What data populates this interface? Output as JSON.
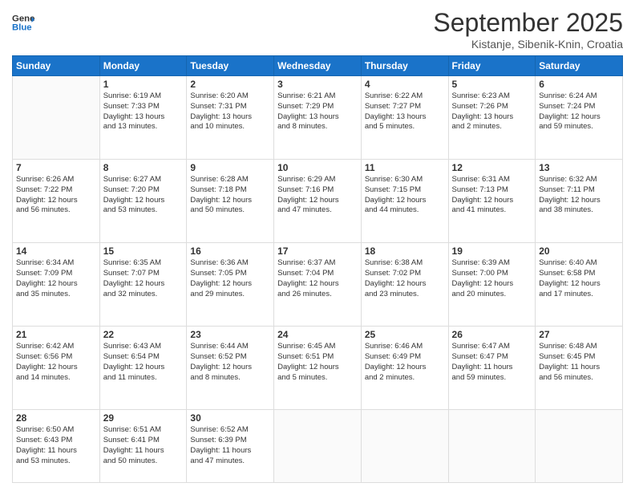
{
  "header": {
    "logo_line1": "General",
    "logo_line2": "Blue",
    "month": "September 2025",
    "location": "Kistanje, Sibenik-Knin, Croatia"
  },
  "days_of_week": [
    "Sunday",
    "Monday",
    "Tuesday",
    "Wednesday",
    "Thursday",
    "Friday",
    "Saturday"
  ],
  "weeks": [
    [
      {
        "day": "",
        "info": ""
      },
      {
        "day": "1",
        "info": "Sunrise: 6:19 AM\nSunset: 7:33 PM\nDaylight: 13 hours\nand 13 minutes."
      },
      {
        "day": "2",
        "info": "Sunrise: 6:20 AM\nSunset: 7:31 PM\nDaylight: 13 hours\nand 10 minutes."
      },
      {
        "day": "3",
        "info": "Sunrise: 6:21 AM\nSunset: 7:29 PM\nDaylight: 13 hours\nand 8 minutes."
      },
      {
        "day": "4",
        "info": "Sunrise: 6:22 AM\nSunset: 7:27 PM\nDaylight: 13 hours\nand 5 minutes."
      },
      {
        "day": "5",
        "info": "Sunrise: 6:23 AM\nSunset: 7:26 PM\nDaylight: 13 hours\nand 2 minutes."
      },
      {
        "day": "6",
        "info": "Sunrise: 6:24 AM\nSunset: 7:24 PM\nDaylight: 12 hours\nand 59 minutes."
      }
    ],
    [
      {
        "day": "7",
        "info": "Sunrise: 6:26 AM\nSunset: 7:22 PM\nDaylight: 12 hours\nand 56 minutes."
      },
      {
        "day": "8",
        "info": "Sunrise: 6:27 AM\nSunset: 7:20 PM\nDaylight: 12 hours\nand 53 minutes."
      },
      {
        "day": "9",
        "info": "Sunrise: 6:28 AM\nSunset: 7:18 PM\nDaylight: 12 hours\nand 50 minutes."
      },
      {
        "day": "10",
        "info": "Sunrise: 6:29 AM\nSunset: 7:16 PM\nDaylight: 12 hours\nand 47 minutes."
      },
      {
        "day": "11",
        "info": "Sunrise: 6:30 AM\nSunset: 7:15 PM\nDaylight: 12 hours\nand 44 minutes."
      },
      {
        "day": "12",
        "info": "Sunrise: 6:31 AM\nSunset: 7:13 PM\nDaylight: 12 hours\nand 41 minutes."
      },
      {
        "day": "13",
        "info": "Sunrise: 6:32 AM\nSunset: 7:11 PM\nDaylight: 12 hours\nand 38 minutes."
      }
    ],
    [
      {
        "day": "14",
        "info": "Sunrise: 6:34 AM\nSunset: 7:09 PM\nDaylight: 12 hours\nand 35 minutes."
      },
      {
        "day": "15",
        "info": "Sunrise: 6:35 AM\nSunset: 7:07 PM\nDaylight: 12 hours\nand 32 minutes."
      },
      {
        "day": "16",
        "info": "Sunrise: 6:36 AM\nSunset: 7:05 PM\nDaylight: 12 hours\nand 29 minutes."
      },
      {
        "day": "17",
        "info": "Sunrise: 6:37 AM\nSunset: 7:04 PM\nDaylight: 12 hours\nand 26 minutes."
      },
      {
        "day": "18",
        "info": "Sunrise: 6:38 AM\nSunset: 7:02 PM\nDaylight: 12 hours\nand 23 minutes."
      },
      {
        "day": "19",
        "info": "Sunrise: 6:39 AM\nSunset: 7:00 PM\nDaylight: 12 hours\nand 20 minutes."
      },
      {
        "day": "20",
        "info": "Sunrise: 6:40 AM\nSunset: 6:58 PM\nDaylight: 12 hours\nand 17 minutes."
      }
    ],
    [
      {
        "day": "21",
        "info": "Sunrise: 6:42 AM\nSunset: 6:56 PM\nDaylight: 12 hours\nand 14 minutes."
      },
      {
        "day": "22",
        "info": "Sunrise: 6:43 AM\nSunset: 6:54 PM\nDaylight: 12 hours\nand 11 minutes."
      },
      {
        "day": "23",
        "info": "Sunrise: 6:44 AM\nSunset: 6:52 PM\nDaylight: 12 hours\nand 8 minutes."
      },
      {
        "day": "24",
        "info": "Sunrise: 6:45 AM\nSunset: 6:51 PM\nDaylight: 12 hours\nand 5 minutes."
      },
      {
        "day": "25",
        "info": "Sunrise: 6:46 AM\nSunset: 6:49 PM\nDaylight: 12 hours\nand 2 minutes."
      },
      {
        "day": "26",
        "info": "Sunrise: 6:47 AM\nSunset: 6:47 PM\nDaylight: 11 hours\nand 59 minutes."
      },
      {
        "day": "27",
        "info": "Sunrise: 6:48 AM\nSunset: 6:45 PM\nDaylight: 11 hours\nand 56 minutes."
      }
    ],
    [
      {
        "day": "28",
        "info": "Sunrise: 6:50 AM\nSunset: 6:43 PM\nDaylight: 11 hours\nand 53 minutes."
      },
      {
        "day": "29",
        "info": "Sunrise: 6:51 AM\nSunset: 6:41 PM\nDaylight: 11 hours\nand 50 minutes."
      },
      {
        "day": "30",
        "info": "Sunrise: 6:52 AM\nSunset: 6:39 PM\nDaylight: 11 hours\nand 47 minutes."
      },
      {
        "day": "",
        "info": ""
      },
      {
        "day": "",
        "info": ""
      },
      {
        "day": "",
        "info": ""
      },
      {
        "day": "",
        "info": ""
      }
    ]
  ]
}
